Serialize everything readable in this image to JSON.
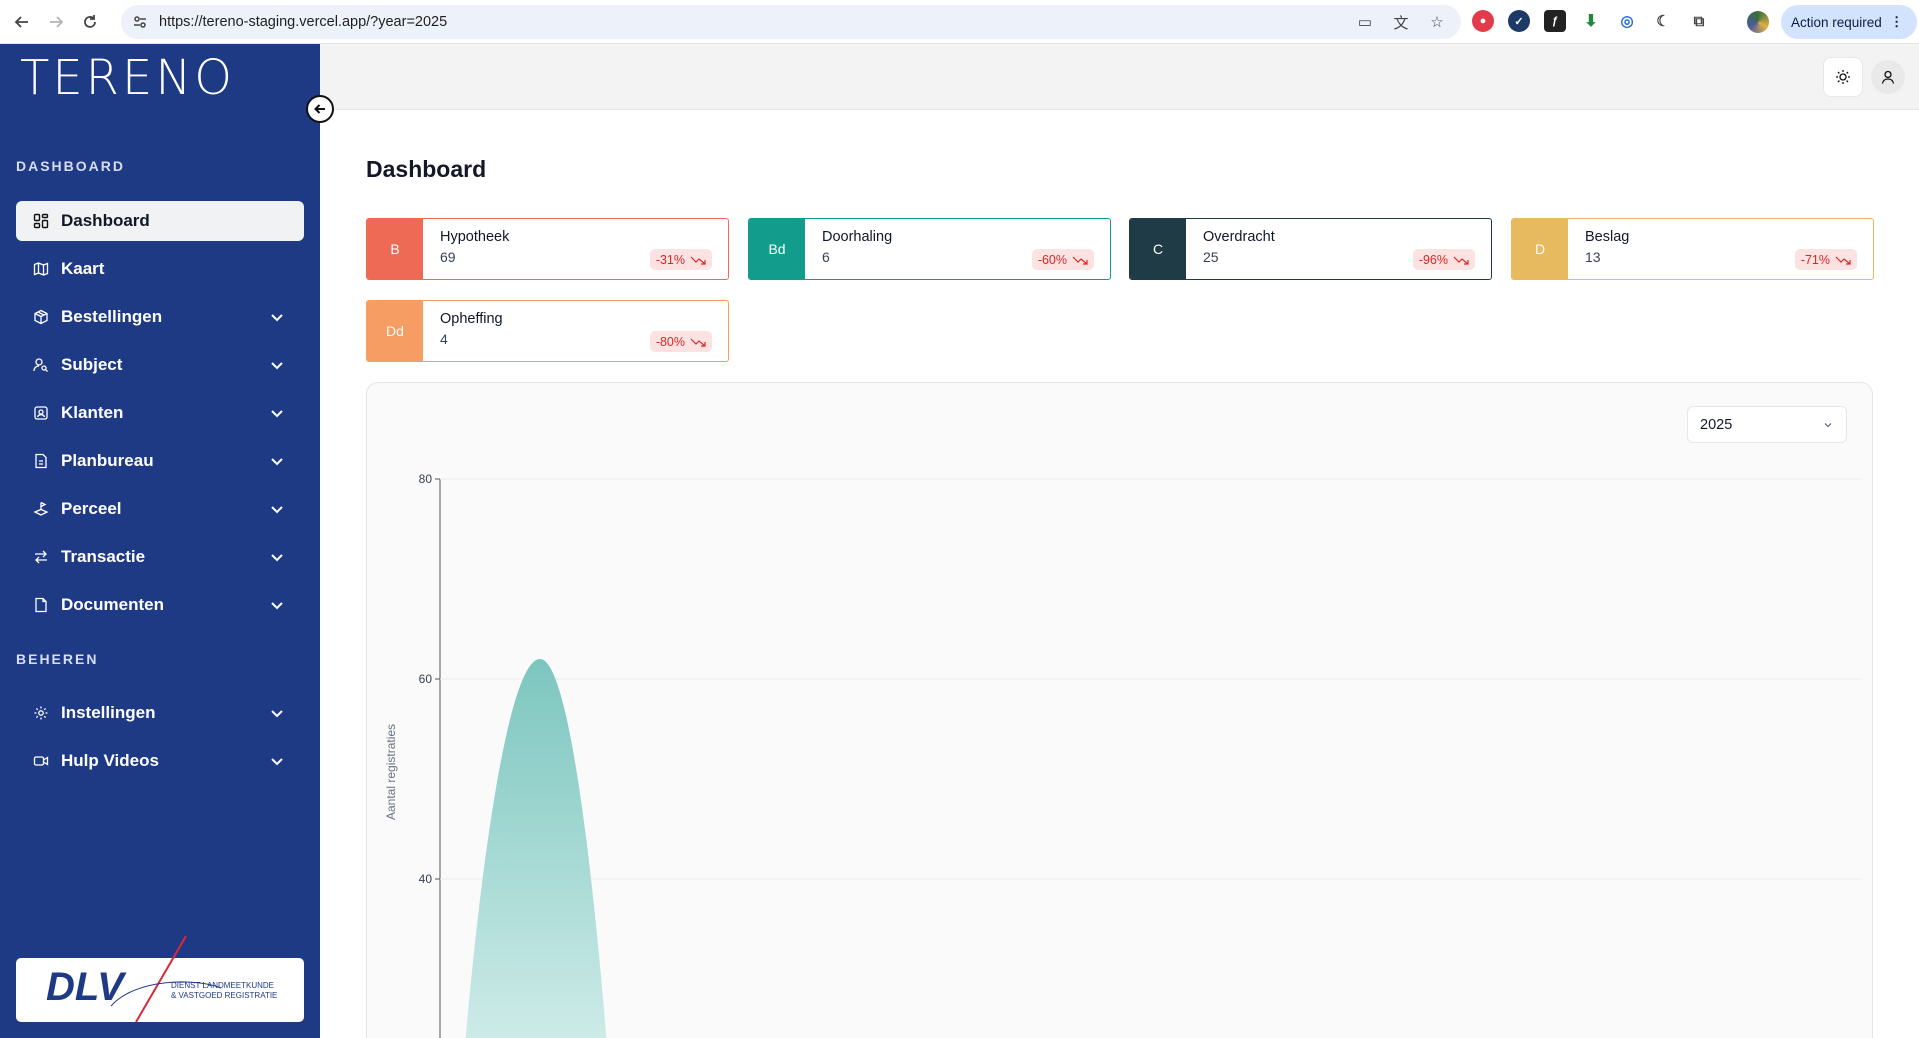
{
  "browser": {
    "url": "https://tereno-staging.vercel.app/?year=2025",
    "action_label": "Action required",
    "action_dots": "⋮"
  },
  "sidebar": {
    "logo": "TERENO",
    "section_dashboard": "DASHBOARD",
    "section_beheren": "BEHEREN",
    "items": [
      {
        "label": "Dashboard",
        "icon": "grid-icon",
        "active": true
      },
      {
        "label": "Kaart",
        "icon": "map-icon"
      },
      {
        "label": "Bestellingen",
        "icon": "package-icon"
      },
      {
        "label": "Subject",
        "icon": "user-search-icon"
      },
      {
        "label": "Klanten",
        "icon": "contact-icon"
      },
      {
        "label": "Planbureau",
        "icon": "file-plan-icon"
      },
      {
        "label": "Perceel",
        "icon": "land-plot-icon"
      },
      {
        "label": "Transactie",
        "icon": "arrows-exchange-icon"
      },
      {
        "label": "Documenten",
        "icon": "file-icon"
      }
    ],
    "manage_items": [
      {
        "label": "Instellingen",
        "icon": "settings-icon"
      },
      {
        "label": "Hulp Videos",
        "icon": "video-icon"
      }
    ],
    "dlv_logo": {
      "mark": "DLV",
      "line1": "DIENST LANDMEETKUNDE",
      "line2": "& VASTGOED REGISTRATIE"
    }
  },
  "page": {
    "title": "Dashboard"
  },
  "stats": [
    {
      "badge": "B",
      "title": "Hypotheek",
      "value": "69",
      "change": "-31%",
      "color": "#ef6a54"
    },
    {
      "badge": "Bd",
      "title": "Doorhaling",
      "value": "6",
      "change": "-60%",
      "color": "#129c8c"
    },
    {
      "badge": "C",
      "title": "Overdracht",
      "value": "25",
      "change": "-96%",
      "color": "#1f3b46"
    },
    {
      "badge": "D",
      "title": "Beslag",
      "value": "13",
      "change": "-71%",
      "color": "#e8ba60"
    },
    {
      "badge": "Dd",
      "title": "Opheffing",
      "value": "4",
      "change": "-80%",
      "color": "#f59d63"
    }
  ],
  "year_select": {
    "value": "2025"
  },
  "chart_data": {
    "type": "area",
    "ylabel": "Aantal registraties",
    "yticks": [
      80,
      60,
      40
    ],
    "ylim": [
      0,
      80
    ],
    "series": [
      {
        "values": [
          0,
          62,
          0
        ],
        "color": "#7cc6bf"
      }
    ]
  }
}
